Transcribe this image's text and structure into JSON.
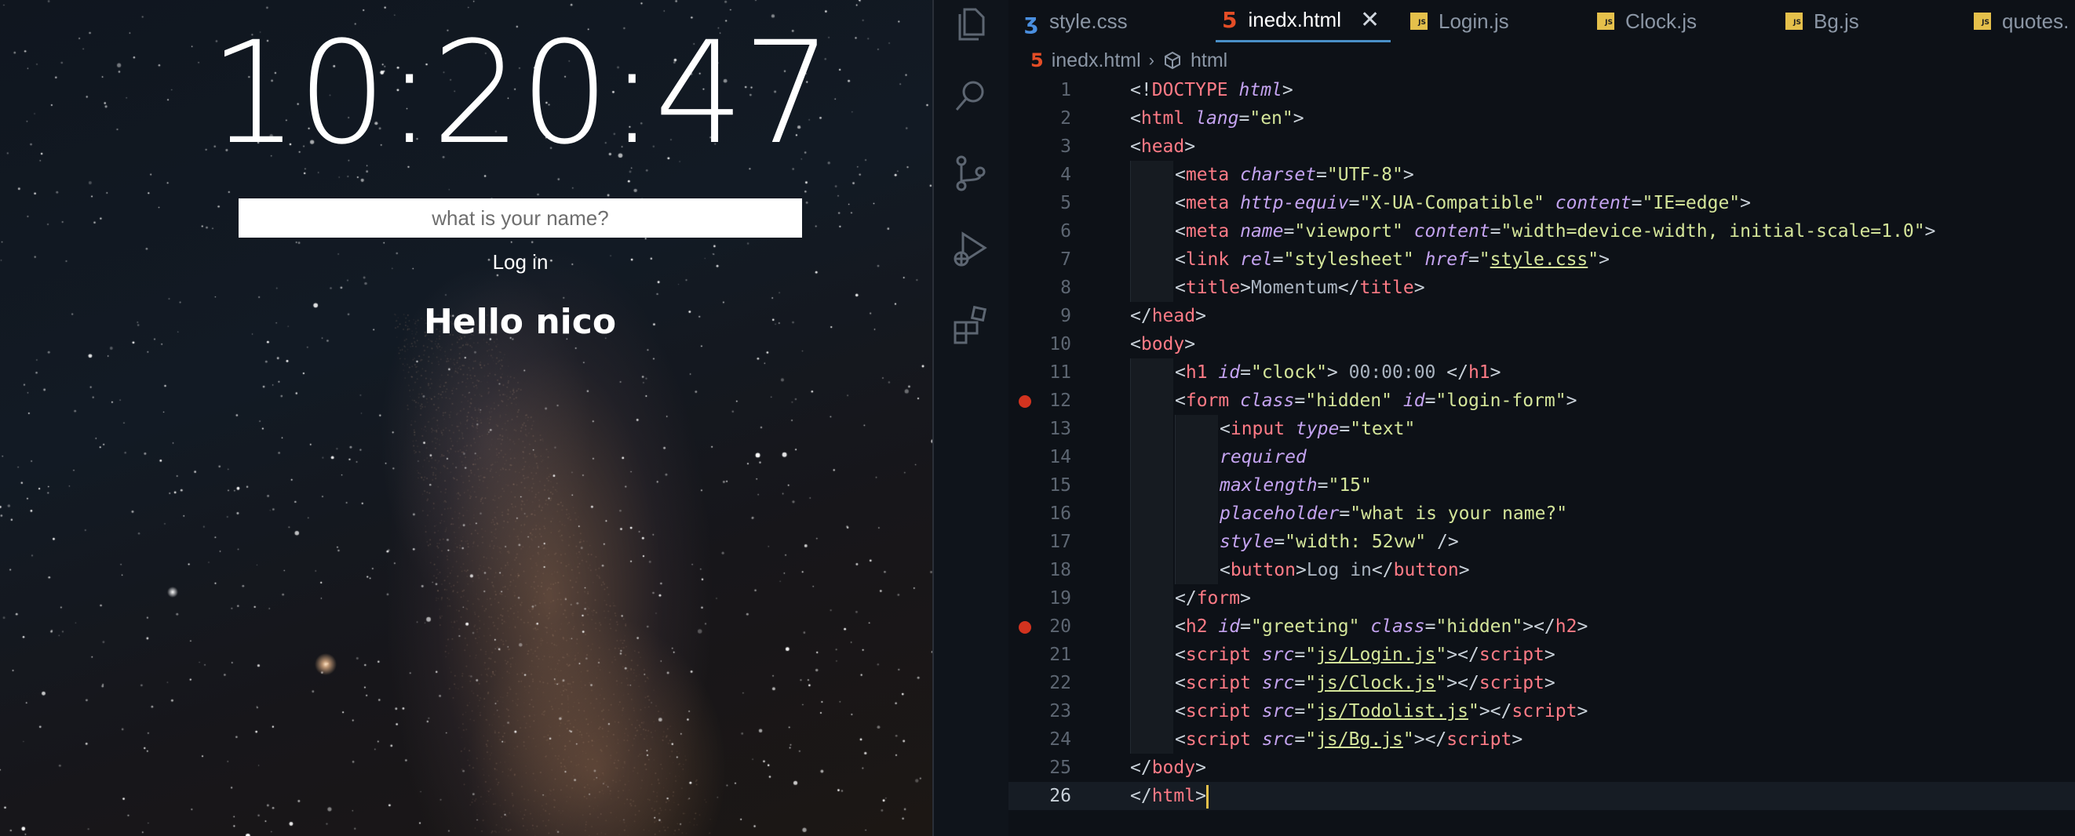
{
  "preview": {
    "clock": "10:20:47",
    "login_placeholder": "what is your name?",
    "login_button": "Log in",
    "greeting": "Hello nico"
  },
  "activity_bar": {
    "icons": [
      "files-icon",
      "search-icon",
      "source-control-icon",
      "run-debug-icon",
      "extensions-icon"
    ]
  },
  "tabs": [
    {
      "label": "style.css",
      "icon": "css-icon",
      "active": false
    },
    {
      "label": "inedx.html",
      "icon": "html-icon",
      "active": true
    },
    {
      "label": "Login.js",
      "icon": "js-icon",
      "active": false
    },
    {
      "label": "Clock.js",
      "icon": "js-icon",
      "active": false
    },
    {
      "label": "Bg.js",
      "icon": "js-icon",
      "active": false
    },
    {
      "label": "quotes.",
      "icon": "js-icon",
      "active": false
    }
  ],
  "breadcrumb": {
    "file": "inedx.html",
    "symbol": "html"
  },
  "editor": {
    "current_line": 26,
    "breakpoints": [
      12,
      20
    ],
    "lines": [
      {
        "n": "1",
        "indent": 0,
        "tokens": [
          [
            "punc",
            "<!"
          ],
          [
            "tag",
            "DOCTYPE"
          ],
          [
            "punc",
            " "
          ],
          [
            "attr",
            "html"
          ],
          [
            "punc",
            ">"
          ]
        ]
      },
      {
        "n": "2",
        "indent": 0,
        "tokens": [
          [
            "punc",
            "<"
          ],
          [
            "tag",
            "html"
          ],
          [
            "punc",
            " "
          ],
          [
            "attr",
            "lang"
          ],
          [
            "punc",
            "="
          ],
          [
            "str",
            "\"en\""
          ],
          [
            "punc",
            ">"
          ]
        ]
      },
      {
        "n": "3",
        "indent": 0,
        "tokens": [
          [
            "punc",
            "<"
          ],
          [
            "tag",
            "head"
          ],
          [
            "punc",
            ">"
          ]
        ]
      },
      {
        "n": "4",
        "indent": 1,
        "tokens": [
          [
            "punc",
            "<"
          ],
          [
            "tag",
            "meta"
          ],
          [
            "punc",
            " "
          ],
          [
            "attr",
            "charset"
          ],
          [
            "punc",
            "="
          ],
          [
            "str",
            "\"UTF-8\""
          ],
          [
            "punc",
            ">"
          ]
        ]
      },
      {
        "n": "5",
        "indent": 1,
        "tokens": [
          [
            "punc",
            "<"
          ],
          [
            "tag",
            "meta"
          ],
          [
            "punc",
            " "
          ],
          [
            "attr",
            "http-equiv"
          ],
          [
            "punc",
            "="
          ],
          [
            "str",
            "\"X-UA-Compatible\""
          ],
          [
            "punc",
            " "
          ],
          [
            "attr",
            "content"
          ],
          [
            "punc",
            "="
          ],
          [
            "str",
            "\"IE=edge\""
          ],
          [
            "punc",
            ">"
          ]
        ]
      },
      {
        "n": "6",
        "indent": 1,
        "tokens": [
          [
            "punc",
            "<"
          ],
          [
            "tag",
            "meta"
          ],
          [
            "punc",
            " "
          ],
          [
            "attr",
            "name"
          ],
          [
            "punc",
            "="
          ],
          [
            "str",
            "\"viewport\""
          ],
          [
            "punc",
            " "
          ],
          [
            "attr",
            "content"
          ],
          [
            "punc",
            "="
          ],
          [
            "str",
            "\"width=device-width, initial-scale=1.0\""
          ],
          [
            "punc",
            ">"
          ]
        ]
      },
      {
        "n": "7",
        "indent": 1,
        "tokens": [
          [
            "punc",
            "<"
          ],
          [
            "tag",
            "link"
          ],
          [
            "punc",
            " "
          ],
          [
            "attr",
            "rel"
          ],
          [
            "punc",
            "="
          ],
          [
            "str",
            "\"stylesheet\""
          ],
          [
            "punc",
            " "
          ],
          [
            "attr",
            "href"
          ],
          [
            "punc",
            "="
          ],
          [
            "str",
            "\""
          ],
          [
            "strlink",
            "style.css"
          ],
          [
            "str",
            "\""
          ],
          [
            "punc",
            ">"
          ]
        ]
      },
      {
        "n": "8",
        "indent": 1,
        "tokens": [
          [
            "punc",
            "<"
          ],
          [
            "tag",
            "title"
          ],
          [
            "punc",
            ">"
          ],
          [
            "text",
            "Momentum"
          ],
          [
            "punc",
            "</"
          ],
          [
            "tag",
            "title"
          ],
          [
            "punc",
            ">"
          ]
        ]
      },
      {
        "n": "9",
        "indent": 0,
        "tokens": [
          [
            "punc",
            "</"
          ],
          [
            "tag",
            "head"
          ],
          [
            "punc",
            ">"
          ]
        ]
      },
      {
        "n": "10",
        "indent": 0,
        "tokens": [
          [
            "punc",
            "<"
          ],
          [
            "tag",
            "body"
          ],
          [
            "punc",
            ">"
          ]
        ]
      },
      {
        "n": "11",
        "indent": 1,
        "tokens": [
          [
            "punc",
            "<"
          ],
          [
            "tag",
            "h1"
          ],
          [
            "punc",
            " "
          ],
          [
            "attr",
            "id"
          ],
          [
            "punc",
            "="
          ],
          [
            "str",
            "\"clock\""
          ],
          [
            "punc",
            "> "
          ],
          [
            "text",
            "00:00:00"
          ],
          [
            "punc",
            " </"
          ],
          [
            "tag",
            "h1"
          ],
          [
            "punc",
            ">"
          ]
        ]
      },
      {
        "n": "12",
        "indent": 1,
        "tokens": [
          [
            "punc",
            "<"
          ],
          [
            "tag",
            "form"
          ],
          [
            "punc",
            " "
          ],
          [
            "attr",
            "class"
          ],
          [
            "punc",
            "="
          ],
          [
            "str",
            "\"hidden\""
          ],
          [
            "punc",
            " "
          ],
          [
            "attr",
            "id"
          ],
          [
            "punc",
            "="
          ],
          [
            "str",
            "\"login-form\""
          ],
          [
            "punc",
            ">"
          ]
        ]
      },
      {
        "n": "13",
        "indent": 2,
        "tokens": [
          [
            "punc",
            "<"
          ],
          [
            "tag",
            "input"
          ],
          [
            "punc",
            " "
          ],
          [
            "attr",
            "type"
          ],
          [
            "punc",
            "="
          ],
          [
            "str",
            "\"text\""
          ]
        ]
      },
      {
        "n": "14",
        "indent": 2,
        "tokens": [
          [
            "attr",
            "required"
          ]
        ]
      },
      {
        "n": "15",
        "indent": 2,
        "tokens": [
          [
            "attr",
            "maxlength"
          ],
          [
            "punc",
            "="
          ],
          [
            "str",
            "\"15\""
          ]
        ]
      },
      {
        "n": "16",
        "indent": 2,
        "tokens": [
          [
            "attr",
            "placeholder"
          ],
          [
            "punc",
            "="
          ],
          [
            "str",
            "\"what is your name?\""
          ]
        ]
      },
      {
        "n": "17",
        "indent": 2,
        "tokens": [
          [
            "attr",
            "style"
          ],
          [
            "punc",
            "="
          ],
          [
            "str",
            "\"width: 52vw\""
          ],
          [
            "punc",
            " />"
          ]
        ]
      },
      {
        "n": "18",
        "indent": 2,
        "tokens": [
          [
            "punc",
            "<"
          ],
          [
            "tag",
            "button"
          ],
          [
            "punc",
            ">"
          ],
          [
            "text",
            "Log in"
          ],
          [
            "punc",
            "</"
          ],
          [
            "tag",
            "button"
          ],
          [
            "punc",
            ">"
          ]
        ]
      },
      {
        "n": "19",
        "indent": 1,
        "tokens": [
          [
            "punc",
            "</"
          ],
          [
            "tag",
            "form"
          ],
          [
            "punc",
            ">"
          ]
        ]
      },
      {
        "n": "20",
        "indent": 1,
        "tokens": [
          [
            "punc",
            "<"
          ],
          [
            "tag",
            "h2"
          ],
          [
            "punc",
            " "
          ],
          [
            "attr",
            "id"
          ],
          [
            "punc",
            "="
          ],
          [
            "str",
            "\"greeting\""
          ],
          [
            "punc",
            " "
          ],
          [
            "attr",
            "class"
          ],
          [
            "punc",
            "="
          ],
          [
            "str",
            "\"hidden\""
          ],
          [
            "punc",
            "></"
          ],
          [
            "tag",
            "h2"
          ],
          [
            "punc",
            ">"
          ]
        ]
      },
      {
        "n": "21",
        "indent": 1,
        "tokens": [
          [
            "punc",
            "<"
          ],
          [
            "tag",
            "script"
          ],
          [
            "punc",
            " "
          ],
          [
            "attr",
            "src"
          ],
          [
            "punc",
            "="
          ],
          [
            "str",
            "\""
          ],
          [
            "strlink",
            "js/Login.js"
          ],
          [
            "str",
            "\""
          ],
          [
            "punc",
            "></"
          ],
          [
            "tag",
            "script"
          ],
          [
            "punc",
            ">"
          ]
        ]
      },
      {
        "n": "22",
        "indent": 1,
        "tokens": [
          [
            "punc",
            "<"
          ],
          [
            "tag",
            "script"
          ],
          [
            "punc",
            " "
          ],
          [
            "attr",
            "src"
          ],
          [
            "punc",
            "="
          ],
          [
            "str",
            "\""
          ],
          [
            "strlink",
            "js/Clock.js"
          ],
          [
            "str",
            "\""
          ],
          [
            "punc",
            "></"
          ],
          [
            "tag",
            "script"
          ],
          [
            "punc",
            ">"
          ]
        ]
      },
      {
        "n": "23",
        "indent": 1,
        "tokens": [
          [
            "punc",
            "<"
          ],
          [
            "tag",
            "script"
          ],
          [
            "punc",
            " "
          ],
          [
            "attr",
            "src"
          ],
          [
            "punc",
            "="
          ],
          [
            "str",
            "\""
          ],
          [
            "strlink",
            "js/Todolist.js"
          ],
          [
            "str",
            "\""
          ],
          [
            "punc",
            "></"
          ],
          [
            "tag",
            "script"
          ],
          [
            "punc",
            ">"
          ]
        ]
      },
      {
        "n": "24",
        "indent": 1,
        "tokens": [
          [
            "punc",
            "<"
          ],
          [
            "tag",
            "script"
          ],
          [
            "punc",
            " "
          ],
          [
            "attr",
            "src"
          ],
          [
            "punc",
            "="
          ],
          [
            "str",
            "\""
          ],
          [
            "strlink",
            "js/Bg.js"
          ],
          [
            "str",
            "\""
          ],
          [
            "punc",
            "></"
          ],
          [
            "tag",
            "script"
          ],
          [
            "punc",
            ">"
          ]
        ]
      },
      {
        "n": "25",
        "indent": 0,
        "tokens": [
          [
            "punc",
            "</"
          ],
          [
            "tag",
            "body"
          ],
          [
            "punc",
            ">"
          ]
        ]
      },
      {
        "n": "26",
        "indent": 0,
        "tokens": [
          [
            "punc",
            "</"
          ],
          [
            "tag",
            "html"
          ],
          [
            "punc",
            ">"
          ]
        ]
      }
    ]
  },
  "colors": {
    "tag": "#ff7b86",
    "attr": "#c4a3f0",
    "string": "#d4e59a",
    "breakpoint": "#d2331f",
    "js_badge": "#e5c04b",
    "html_icon": "#e44d26",
    "css_icon": "#4a8fe0"
  }
}
